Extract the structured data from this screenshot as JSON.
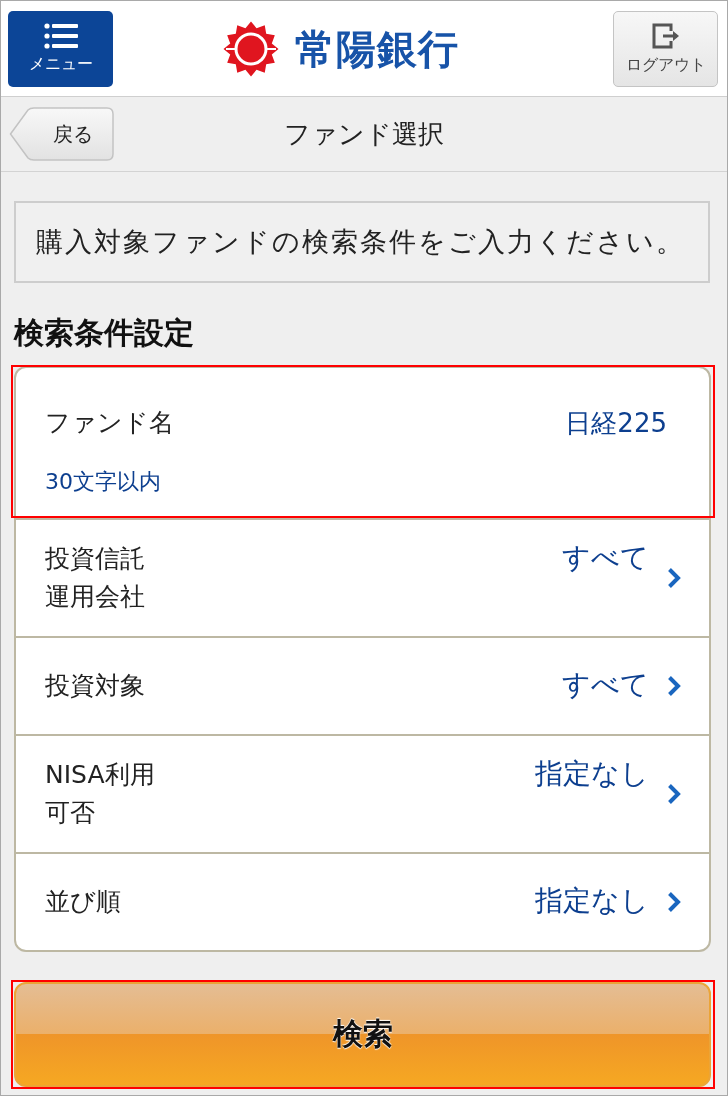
{
  "header": {
    "menu_button": "メニュー",
    "logo_text": "常陽銀行",
    "logout_button": "ログアウト"
  },
  "nav_bar": {
    "back_button": "戻る",
    "title": "ファンド選択"
  },
  "notice": "購入対象ファンドの検索条件をご入力ください。",
  "section_title": "検索条件設定",
  "conditions": [
    {
      "kind": "input",
      "label": "ファンド名",
      "value": "日経225",
      "note": "30文字以内",
      "highlighted": true
    },
    {
      "kind": "select",
      "label": "投資信託運用会社",
      "value": "すべて",
      "highlighted": false
    },
    {
      "kind": "select",
      "label": "投資対象",
      "value": "すべて",
      "highlighted": false
    },
    {
      "kind": "select",
      "label": "NISA利用可否",
      "value": "指定なし",
      "highlighted": false
    },
    {
      "kind": "select",
      "label": "並び順",
      "value": "指定なし",
      "highlighted": false
    }
  ],
  "search_button": {
    "label": "検索",
    "highlighted": true
  }
}
